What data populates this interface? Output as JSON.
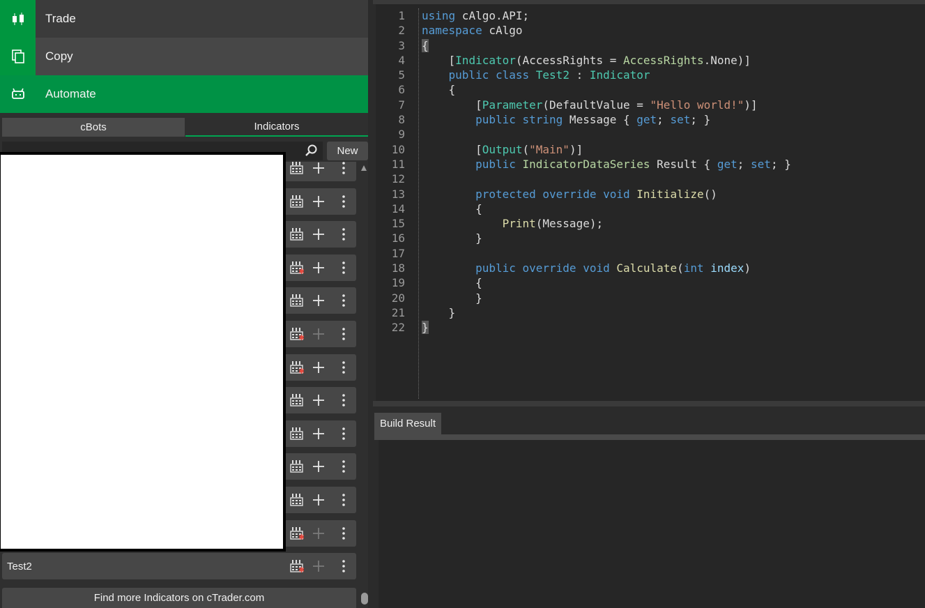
{
  "nav": {
    "trade": "Trade",
    "copy": "Copy",
    "automate": "Automate"
  },
  "tabs": {
    "cbots": "cBots",
    "indicators": "Indicators"
  },
  "toolbar": {
    "new_label": "New",
    "search_placeholder": ""
  },
  "list": {
    "rows": [
      {
        "name": "",
        "has_star": false,
        "plus_enabled": true
      },
      {
        "name": "",
        "has_star": false,
        "plus_enabled": true
      },
      {
        "name": "",
        "has_star": false,
        "plus_enabled": true
      },
      {
        "name": "",
        "has_star": true,
        "plus_enabled": true
      },
      {
        "name": "",
        "has_star": false,
        "plus_enabled": true
      },
      {
        "name": "",
        "has_star": true,
        "plus_enabled": false
      },
      {
        "name": "",
        "has_star": true,
        "plus_enabled": true
      },
      {
        "name": "",
        "has_star": false,
        "plus_enabled": true
      },
      {
        "name": "",
        "has_star": false,
        "plus_enabled": true
      },
      {
        "name": "",
        "has_star": false,
        "plus_enabled": true
      },
      {
        "name": "",
        "has_star": false,
        "plus_enabled": true
      },
      {
        "name": "",
        "has_star": true,
        "plus_enabled": false
      },
      {
        "name": "Test2",
        "has_star": true,
        "plus_enabled": false
      }
    ],
    "find_more": "Find more Indicators on cTrader.com"
  },
  "editor": {
    "line_numbers": [
      "1",
      "2",
      "3",
      "4",
      "5",
      "6",
      "7",
      "8",
      "9",
      "10",
      "11",
      "12",
      "13",
      "14",
      "15",
      "16",
      "17",
      "18",
      "19",
      "20",
      "21",
      "22"
    ],
    "l1": {
      "a": "using",
      "b": " cAlgo.API;"
    },
    "l2": {
      "a": "namespace",
      "b": " cAlgo"
    },
    "l3": "{",
    "l4": {
      "a": "    [",
      "b": "Indicator",
      "c": "(AccessRights = ",
      "d": "AccessRights",
      "e": ".None)]"
    },
    "l5": {
      "a": "    ",
      "b": "public",
      "c": " ",
      "d": "class",
      "e": " ",
      "f": "Test2",
      "g": " : ",
      "h": "Indicator"
    },
    "l6": "    {",
    "l7": {
      "a": "        [",
      "b": "Parameter",
      "c": "(DefaultValue = ",
      "d": "\"Hello world!\"",
      "e": ")]"
    },
    "l8": {
      "a": "        ",
      "b": "public",
      "c": " ",
      "d": "string",
      "e": " Message { ",
      "f": "get",
      "g": "; ",
      "h": "set",
      "i": "; }"
    },
    "l9": "",
    "l10": {
      "a": "        [",
      "b": "Output",
      "c": "(",
      "d": "\"Main\"",
      "e": ")]"
    },
    "l11": {
      "a": "        ",
      "b": "public",
      "c": " ",
      "d": "IndicatorDataSeries",
      "e": " Result { ",
      "f": "get",
      "g": "; ",
      "h": "set",
      "i": "; }"
    },
    "l12": "",
    "l13": {
      "a": "        ",
      "b": "protected",
      "c": " ",
      "d": "override",
      "e": " ",
      "f": "void",
      "g": " ",
      "h": "Initialize",
      "i": "()"
    },
    "l14": "        {",
    "l15": {
      "a": "            ",
      "b": "Print",
      "c": "(Message);"
    },
    "l16": "        }",
    "l17": "",
    "l18": {
      "a": "        ",
      "b": "public",
      "c": " ",
      "d": "override",
      "e": " ",
      "f": "void",
      "g": " ",
      "h": "Calculate",
      "i": "(",
      "j": "int",
      "k": " ",
      "l": "index",
      "m": ")"
    },
    "l19": "        {",
    "l20": "        }",
    "l21": "    }",
    "l22": "}"
  },
  "build": {
    "tab_label": "Build Result"
  },
  "colors": {
    "accent": "#00963f",
    "automate_bg": "#009245"
  }
}
